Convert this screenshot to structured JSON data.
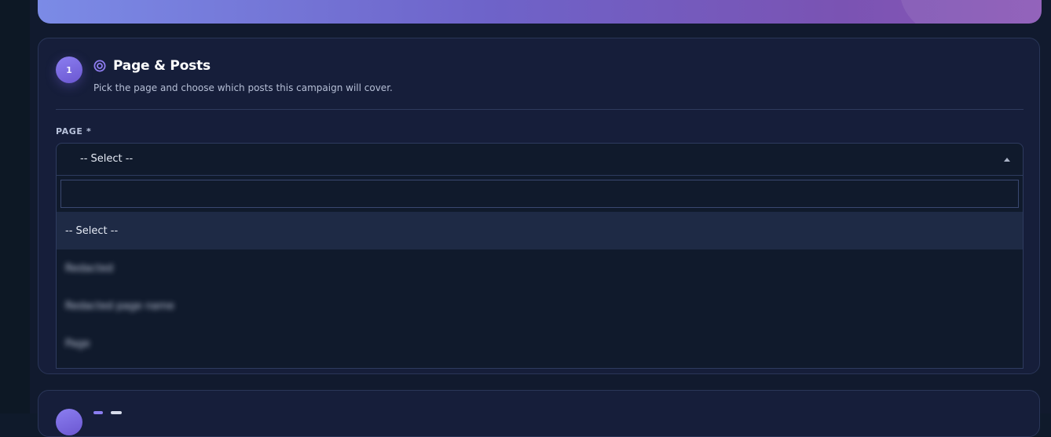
{
  "step": {
    "number": "1",
    "icon": "target-icon",
    "title": "Page & Posts",
    "subtitle": "Pick the page and choose which posts this campaign will cover."
  },
  "page_field": {
    "label": "PAGE *",
    "selected_value": "-- Select --",
    "search_value": "",
    "options": [
      {
        "label": "-- Select --",
        "highlighted": true,
        "blurred": false
      },
      {
        "label": "Redacted",
        "highlighted": false,
        "blurred": true
      },
      {
        "label": "Redacted page name",
        "highlighted": false,
        "blurred": true
      },
      {
        "label": "Page",
        "highlighted": false,
        "blurred": true
      }
    ]
  },
  "colors": {
    "accent": "#7c6ce6",
    "card_background": "#161e3a",
    "input_background": "#101a2c",
    "highlight_row": "#1e2a45"
  }
}
